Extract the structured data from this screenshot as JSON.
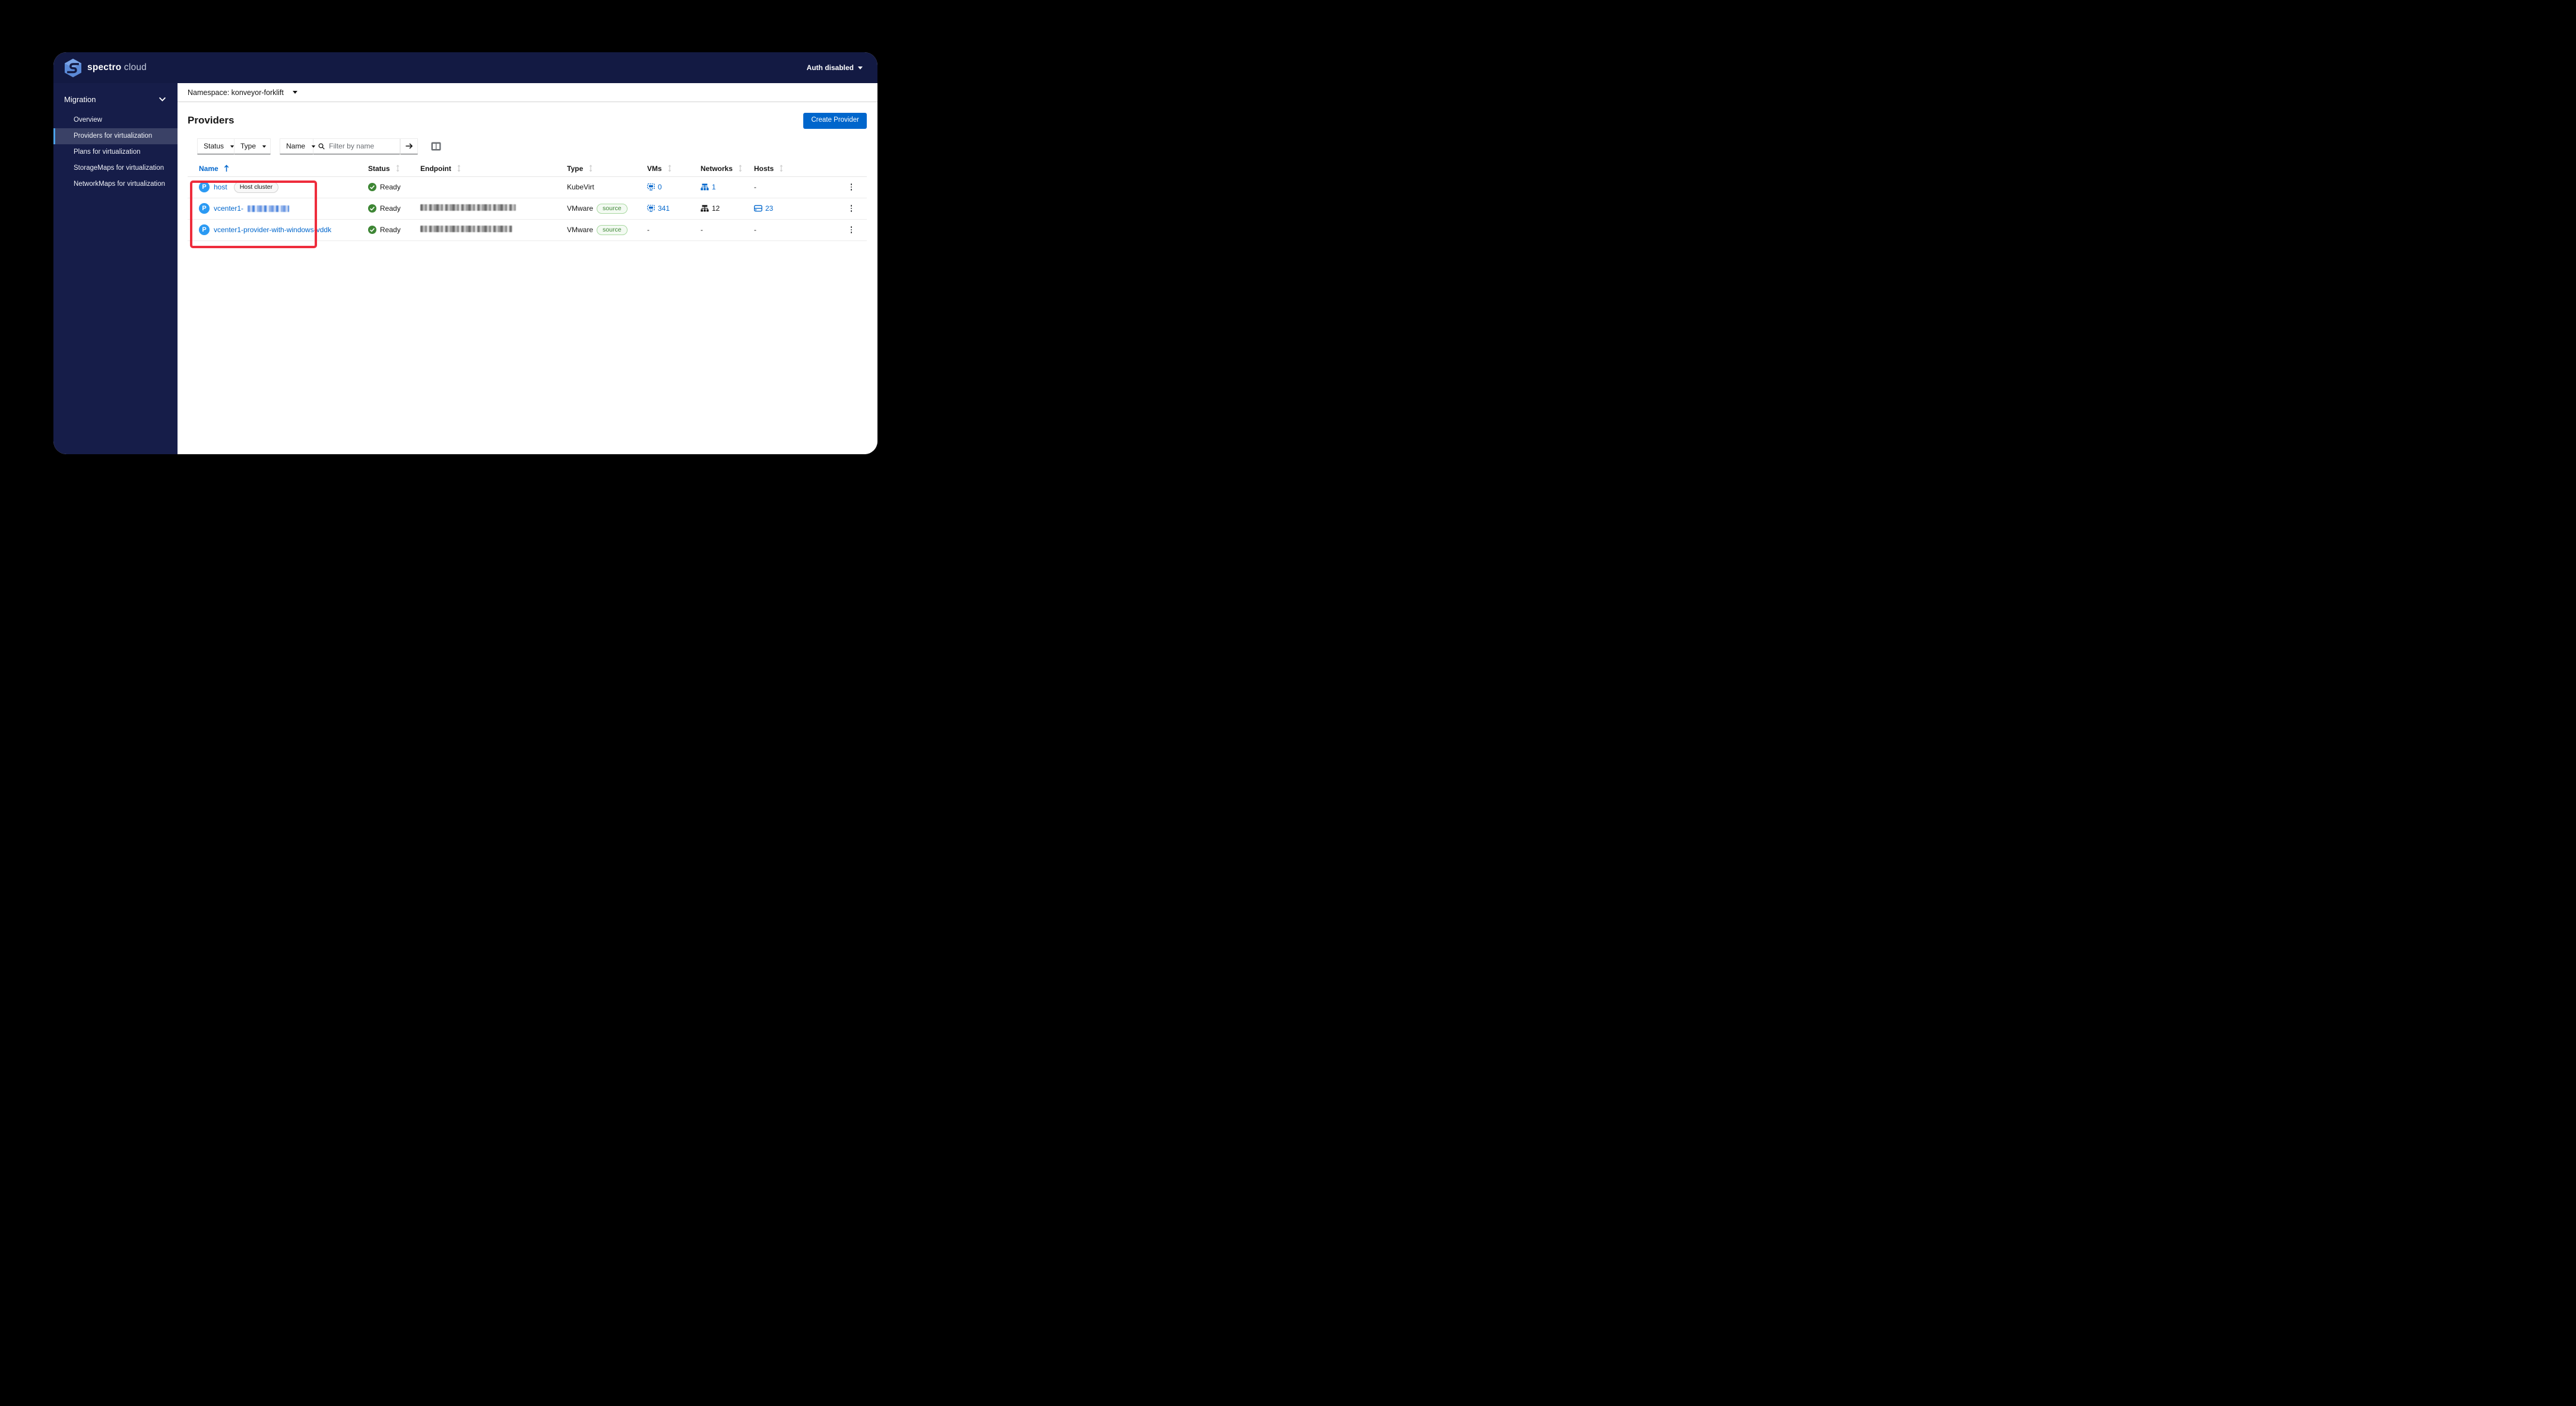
{
  "brand": {
    "name_bold": "spectro",
    "name_light": "cloud"
  },
  "topbar": {
    "auth_label": "Auth disabled"
  },
  "sidebar": {
    "group_label": "Migration",
    "items": [
      {
        "label": "Overview"
      },
      {
        "label": "Providers for virtualization"
      },
      {
        "label": "Plans for virtualization"
      },
      {
        "label": "StorageMaps for virtualization"
      },
      {
        "label": "NetworkMaps for virtualization"
      }
    ],
    "active_item": "Providers for virtualization"
  },
  "namespace_bar": {
    "label": "Namespace: konveyor-forklift"
  },
  "page": {
    "title": "Providers",
    "create_button": "Create Provider"
  },
  "toolbar": {
    "status_filter": "Status",
    "type_filter": "Type",
    "name_filter": "Name",
    "search_placeholder": "Filter by name"
  },
  "table": {
    "headers": [
      "Name",
      "Status",
      "Endpoint",
      "Type",
      "VMs",
      "Networks",
      "Hosts"
    ],
    "sort": {
      "column": "Name",
      "direction": "ascending"
    },
    "rows": [
      {
        "name": "host",
        "name_badge": "Host cluster",
        "status": "Ready",
        "endpoint": "",
        "type": "KubeVirt",
        "type_badge": "",
        "vms": "0",
        "networks": "1",
        "hosts": "-"
      },
      {
        "name": "vcenter1-",
        "name_redacted": true,
        "status": "Ready",
        "endpoint_redacted": true,
        "type": "VMware",
        "type_badge": "source",
        "vms": "341",
        "networks": "12",
        "hosts": "23"
      },
      {
        "name": "vcenter1-provider-with-windows-vddk",
        "status": "Ready",
        "endpoint_redacted": true,
        "type": "VMware",
        "type_badge": "source",
        "vms": "-",
        "networks": "-",
        "hosts": "-"
      }
    ]
  },
  "annotation": {
    "shape": "rectangle",
    "color": "#ee2c3c",
    "around": "provider name cells"
  },
  "colors": {
    "topbar_bg": "#131a43",
    "sidebar_bg": "#161d49",
    "active_nav_bg": "#3a4166",
    "active_nav_accent": "#4ba1e9",
    "primary_button": "#0066cc",
    "link": "#0066cc",
    "provider_icon": "#2b9af3",
    "ready_green": "#3e8635",
    "source_badge_green": "#3e8635"
  }
}
